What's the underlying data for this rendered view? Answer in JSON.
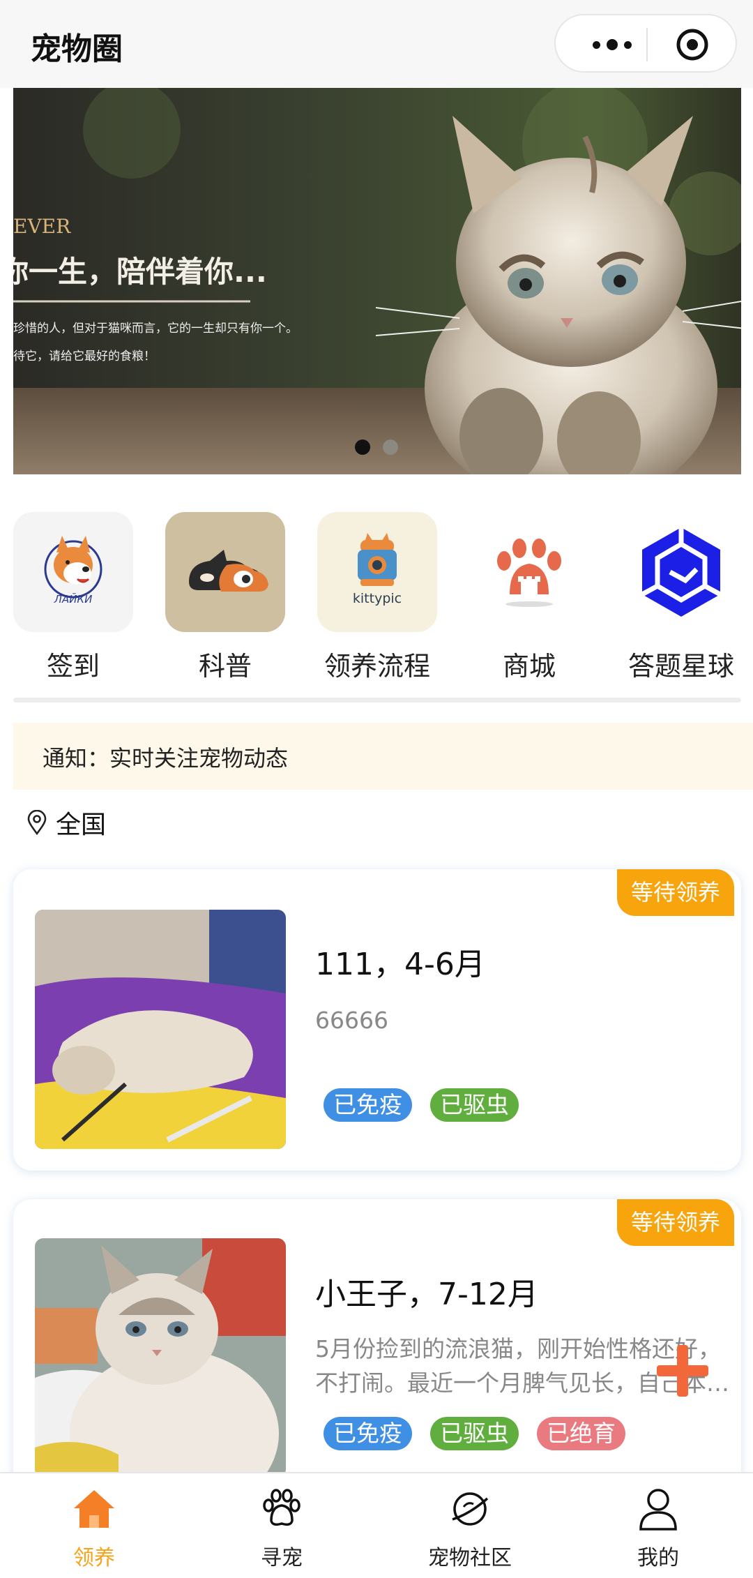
{
  "header": {
    "title": "宠物圈"
  },
  "banner": {
    "text_lines": [
      "EVER",
      "你一生，陪伴着你...",
      "珍惜的人，但对于猫咪而言，它的一生却只有你一个。",
      "待它，请给它最好的食粮！"
    ],
    "dots_total": 2,
    "dots_active": 1
  },
  "shortcuts": [
    {
      "label": "签到",
      "icon": "husky-logo-icon",
      "icon_text": "ЛАЙКИ"
    },
    {
      "label": "科普",
      "icon": "cat-dog-icon"
    },
    {
      "label": "领养流程",
      "icon": "kittypic-icon",
      "icon_text": "kittypic"
    },
    {
      "label": "商城",
      "icon": "paw-shop-icon"
    },
    {
      "label": "答题星球",
      "icon": "hexagon-icon"
    }
  ],
  "notice": {
    "text": "通知：实时关注宠物动态"
  },
  "location": {
    "text": "全国",
    "icon": "location-pin-icon"
  },
  "cards": [
    {
      "badge": "等待领养",
      "title": "111，4-6月",
      "desc": "66666",
      "tags": [
        "已免疫",
        "已驱虫"
      ]
    },
    {
      "badge": "等待领养",
      "title": "小王子，7-12月",
      "desc": "5月份捡到的流浪猫，刚开始性格还好，不打闹。最近一个月脾气见长，自己本…",
      "tags": [
        "已免疫",
        "已驱虫",
        "已绝育"
      ]
    }
  ],
  "tabbar": {
    "active": 0,
    "items": [
      {
        "label": "领养",
        "icon": "home-icon"
      },
      {
        "label": "寻宠",
        "icon": "paw-icon"
      },
      {
        "label": "宠物社区",
        "icon": "planet-icon"
      },
      {
        "label": "我的",
        "icon": "user-icon"
      }
    ]
  },
  "colors": {
    "accent": "#f5a31a",
    "badge": "#f7a40d",
    "immune": "#3f8fe5",
    "deworm": "#5fae3e",
    "neutered": "#e97a80"
  }
}
